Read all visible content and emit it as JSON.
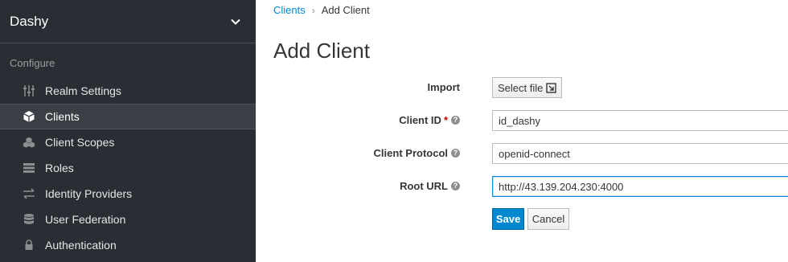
{
  "sidebar": {
    "realm_name": "Dashy",
    "section_label": "Configure",
    "items": [
      {
        "label": "Realm Settings",
        "icon": "sliders-icon"
      },
      {
        "label": "Clients",
        "icon": "cube-icon",
        "active": true
      },
      {
        "label": "Client Scopes",
        "icon": "cubes-icon"
      },
      {
        "label": "Roles",
        "icon": "list-icon"
      },
      {
        "label": "Identity Providers",
        "icon": "exchange-icon"
      },
      {
        "label": "User Federation",
        "icon": "database-icon"
      },
      {
        "label": "Authentication",
        "icon": "lock-icon"
      }
    ]
  },
  "breadcrumb": {
    "parent": "Clients",
    "separator": "›",
    "current": "Add Client"
  },
  "page": {
    "title": "Add Client"
  },
  "form": {
    "import_label": "Import",
    "select_file_label": "Select file",
    "client_id_label": "Client ID",
    "client_id_required": "*",
    "client_id_value": "id_dashy",
    "client_protocol_label": "Client Protocol",
    "client_protocol_value": "openid-connect",
    "root_url_label": "Root URL",
    "root_url_value": "http://43.139.204.230:4000",
    "help_glyph": "?",
    "save_label": "Save",
    "cancel_label": "Cancel"
  },
  "colors": {
    "sidebar_bg": "#292e34",
    "active_item_bg": "#393f44",
    "accent": "#0088ce",
    "required": "#cc0000"
  }
}
